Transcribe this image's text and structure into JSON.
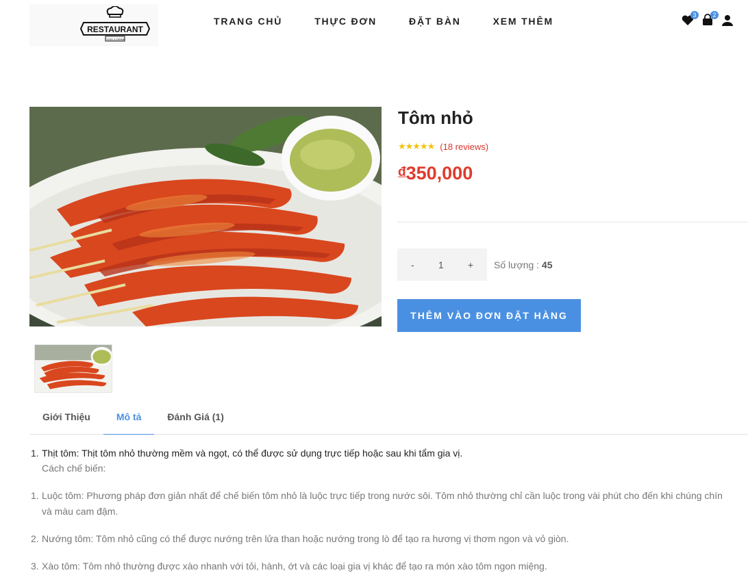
{
  "logo": {
    "text": "RESTAURANT",
    "sub": "FOOD & DRINK"
  },
  "nav": {
    "items": [
      "TRANG CHỦ",
      "THỰC ĐƠN",
      "ĐẶT BÀN",
      "XEM THÊM"
    ]
  },
  "header_icons": {
    "wishlist_count": "3",
    "cart_count": "2"
  },
  "product": {
    "title": "Tôm nhỏ",
    "rating_stars": 4.5,
    "reviews": "(18 reviews)",
    "currency": "đ",
    "price": "350,000",
    "qty_minus": "-",
    "qty_value": "1",
    "qty_plus": "+",
    "stock_label": "Số lượng : ",
    "stock_value": "45",
    "add_button": "THÊM VÀO ĐƠN ĐẶT HÀNG"
  },
  "tabs": [
    "Giới Thiệu",
    "Mô tả",
    "Đánh Giá (1)"
  ],
  "description": {
    "first_item": "Thịt tôm: Thịt tôm nhỏ thường mềm và ngọt, có thể được sử dụng trực tiếp hoặc sau khi tẩm gia vị.",
    "method_label": "Cách chế biến:",
    "methods": [
      "Luộc tôm: Phương pháp đơn giản nhất để chế biến tôm nhỏ là luộc trực tiếp trong nước sôi. Tôm nhỏ thường chỉ cần luộc trong vài phút cho đến khi chúng chín và màu cam đậm.",
      "Nướng tôm: Tôm nhỏ cũng có thể được nướng trên lửa than hoặc nướng trong lò để tạo ra hương vị thơm ngon và vỏ giòn.",
      "Xào tôm: Tôm nhỏ thường được xào nhanh với tỏi, hành, ớt và các loại gia vị khác để tạo ra món xào tôm ngon miệng."
    ]
  }
}
